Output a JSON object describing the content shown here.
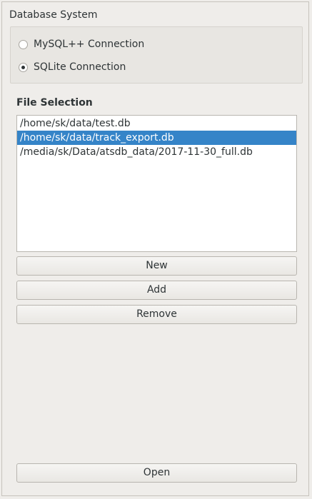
{
  "database_system": {
    "title": "Database System",
    "options": [
      {
        "label": "MySQL++ Connection",
        "checked": false
      },
      {
        "label": "SQLite Connection",
        "checked": true
      }
    ]
  },
  "file_selection": {
    "title": "File Selection",
    "files": [
      {
        "path": "/home/sk/data/test.db",
        "selected": false
      },
      {
        "path": "/home/sk/data/track_export.db",
        "selected": true
      },
      {
        "path": "/media/sk/Data/atsdb_data/2017-11-30_full.db",
        "selected": false
      }
    ]
  },
  "buttons": {
    "new_label": "New",
    "add_label": "Add",
    "remove_label": "Remove",
    "open_label": "Open"
  },
  "colors": {
    "selection": "#3584c8",
    "background": "#efedea"
  }
}
